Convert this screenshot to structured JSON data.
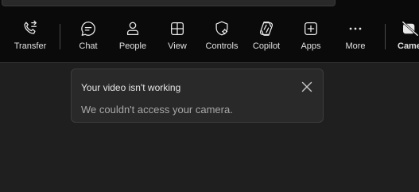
{
  "toolbar": {
    "items": [
      {
        "label": "Transfer",
        "icon": "phone-transfer-icon"
      },
      {
        "label": "Chat",
        "icon": "chat-icon"
      },
      {
        "label": "People",
        "icon": "people-icon"
      },
      {
        "label": "View",
        "icon": "grid-view-icon"
      },
      {
        "label": "Controls",
        "icon": "shield-gear-icon"
      },
      {
        "label": "Copilot",
        "icon": "copilot-icon"
      },
      {
        "label": "Apps",
        "icon": "add-app-icon"
      },
      {
        "label": "More",
        "icon": "more-dots-icon"
      },
      {
        "label": "Camera",
        "icon": "camera-off-icon"
      }
    ]
  },
  "toast": {
    "title": "Your video isn't working",
    "message": "We couldn't access your camera.",
    "close_icon": "close-icon"
  },
  "colors": {
    "background": "#1f1f1f",
    "toolbar": "#0a0a0a",
    "toast_bg": "#292929",
    "text": "#e6e6e6",
    "muted_text": "#a8a8a8"
  }
}
